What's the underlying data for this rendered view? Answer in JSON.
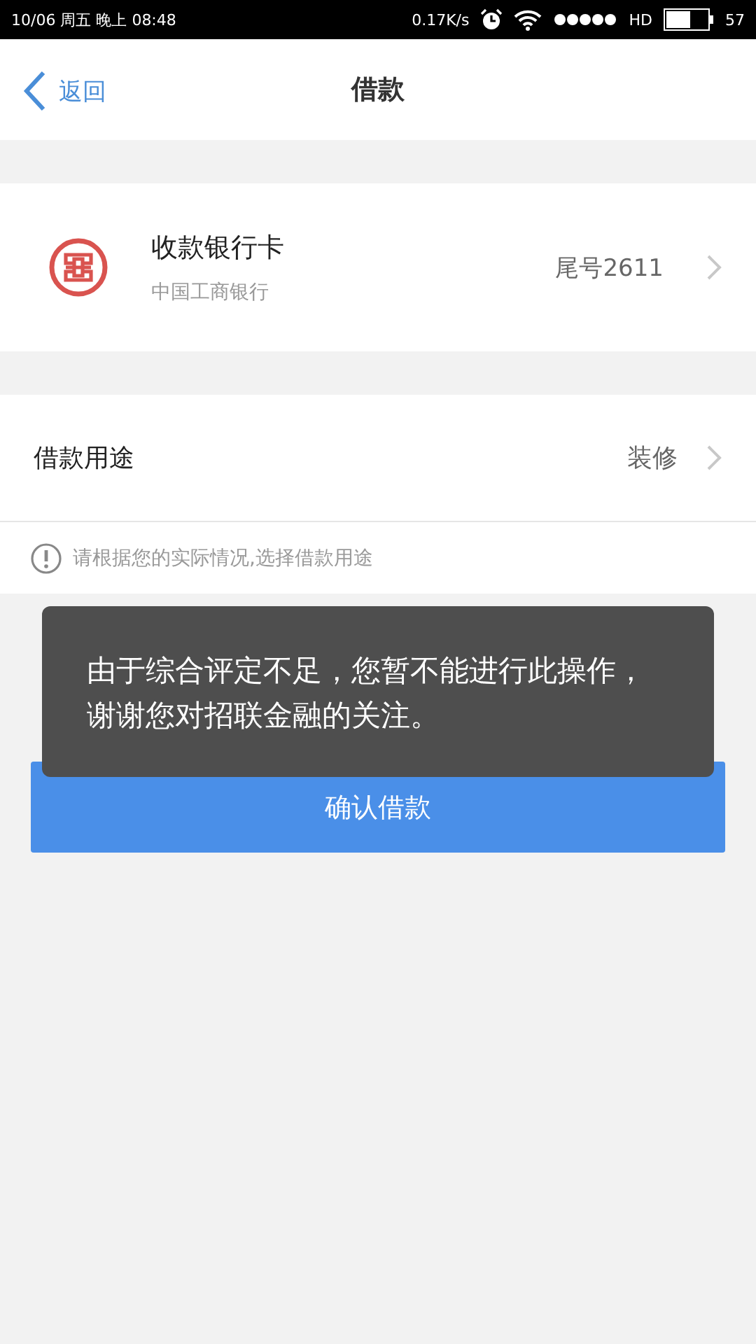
{
  "status_bar": {
    "time": "10/06 周五 晚上 08:48",
    "speed": "0.17K/s",
    "network": "HD",
    "battery": "57"
  },
  "header": {
    "back": "返回",
    "title": "借款"
  },
  "bank_card": {
    "title": "收款银行卡",
    "bank": "中国工商银行",
    "tail": "尾号2611"
  },
  "purpose": {
    "label": "借款用途",
    "value": "装修",
    "hint": "请根据您的实际情况,选择借款用途"
  },
  "confirm_button": "确认借款",
  "toast": {
    "message": "由于综合评定不足，您暂不能进行此操作，谢谢您对招联金融的关注。"
  }
}
